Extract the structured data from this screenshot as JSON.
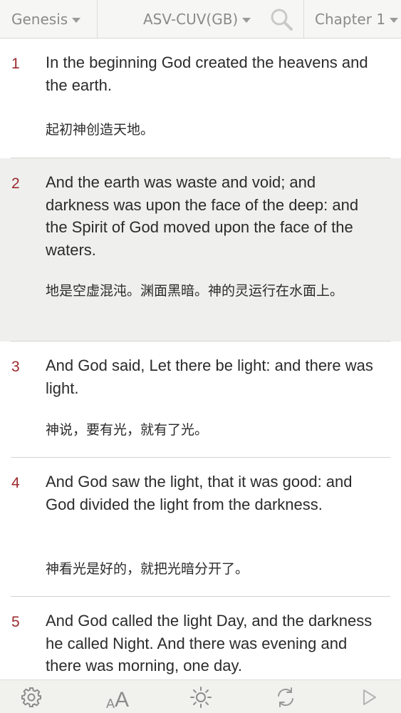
{
  "header": {
    "book_label": "Genesis",
    "version_label": "ASV-CUV(GB)",
    "chapter_label": "Chapter 1"
  },
  "verses": [
    {
      "number": "1",
      "en": "In the beginning God created the heavens and the earth.",
      "zh": "起初神创造天地。"
    },
    {
      "number": "2",
      "en": "And the earth was waste and void; and darkness was upon the face of the deep: and the Spirit of God moved upon the face of the waters.",
      "zh": "地是空虚混沌。渊面黑暗。神的灵运行在水面上。"
    },
    {
      "number": "3",
      "en": "And God said, Let there be light: and there was light.",
      "zh": "神说，要有光，就有了光。"
    },
    {
      "number": "4",
      "en": "And God saw the light, that it was good: and God divided the light from the darkness.",
      "zh": "神看光是好的，就把光暗分开了。"
    },
    {
      "number": "5",
      "en": "And God called the light Day, and the darkness he called Night. And there was evening and there was morning, one day.",
      "zh": ""
    }
  ],
  "toolbar": {
    "font_small": "A",
    "font_large": "A",
    "icons": [
      "gear-icon",
      "font-size-icon",
      "brightness-icon",
      "sync-icon",
      "play-icon"
    ]
  },
  "colors": {
    "verse_number": "#9b2a2e",
    "highlight": "#efefee",
    "toolbar_icon": "#8c8c8a"
  }
}
